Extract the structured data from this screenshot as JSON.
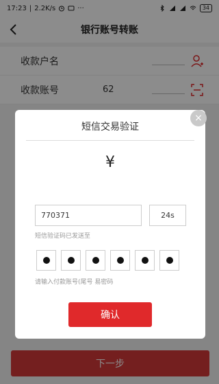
{
  "status_bar": {
    "time": "17:23",
    "speed": "2.2K/s",
    "more": "···",
    "battery": "34"
  },
  "nav": {
    "title": "银行账号转账"
  },
  "form": {
    "payee_name_label": "收款户名",
    "payee_account_label": "收款账号",
    "payee_account_value": "62"
  },
  "next_button": "下一步",
  "dialog": {
    "title": "短信交易验证",
    "close": "×",
    "currency_symbol": "¥",
    "sms_code_value": "770371",
    "countdown": "24s",
    "sms_sent_note": "短信验证码已发送至",
    "pin_note": "请输入付款账号(尾号 易密码",
    "pin_digits": 6,
    "confirm_button": "确认"
  },
  "colors": {
    "accent": "#e0292b",
    "overlay": "rgba(0,0,0,0.45)"
  }
}
